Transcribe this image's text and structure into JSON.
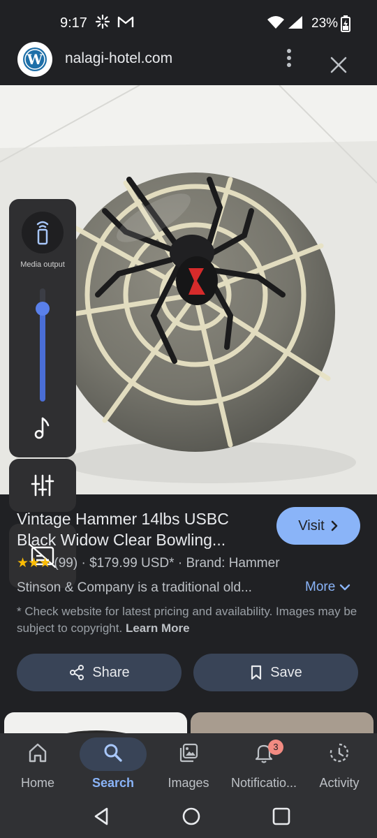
{
  "status_bar": {
    "time": "9:17",
    "battery": "23%"
  },
  "browser": {
    "url": "nalagi-hotel.com",
    "site_logo_letter": "W"
  },
  "media_panel": {
    "output_label": "Media output",
    "volume_level": 0.82
  },
  "result": {
    "title_line1": "Vintage Hammer 14lbs USBC",
    "title_line2": "Black Widow Clear Bowling...",
    "visit_label": "Visit",
    "stars": "★★★",
    "review_count": "(99)",
    "price": "$179.99 USD*",
    "brand": "Brand: Hammer",
    "description": "Stinson & Company is a traditional old...",
    "more_label": "More",
    "disclaimer": "* Check website for latest pricing and availability. Images may be subject to copyright.",
    "learn_more": "Learn More",
    "share_label": "Share",
    "save_label": "Save"
  },
  "bottom_nav": {
    "items": [
      {
        "label": "Home",
        "icon": "home-icon"
      },
      {
        "label": "Search",
        "icon": "search-icon"
      },
      {
        "label": "Images",
        "icon": "images-icon"
      },
      {
        "label": "Notificatio...",
        "icon": "bell-icon",
        "badge": "3"
      },
      {
        "label": "Activity",
        "icon": "activity-icon"
      }
    ],
    "active": "Search"
  },
  "colors": {
    "accent": "#8ab4f8",
    "background": "#202124",
    "button": "#394457",
    "badge": "#f28b82",
    "stars": "#fbbc04"
  }
}
